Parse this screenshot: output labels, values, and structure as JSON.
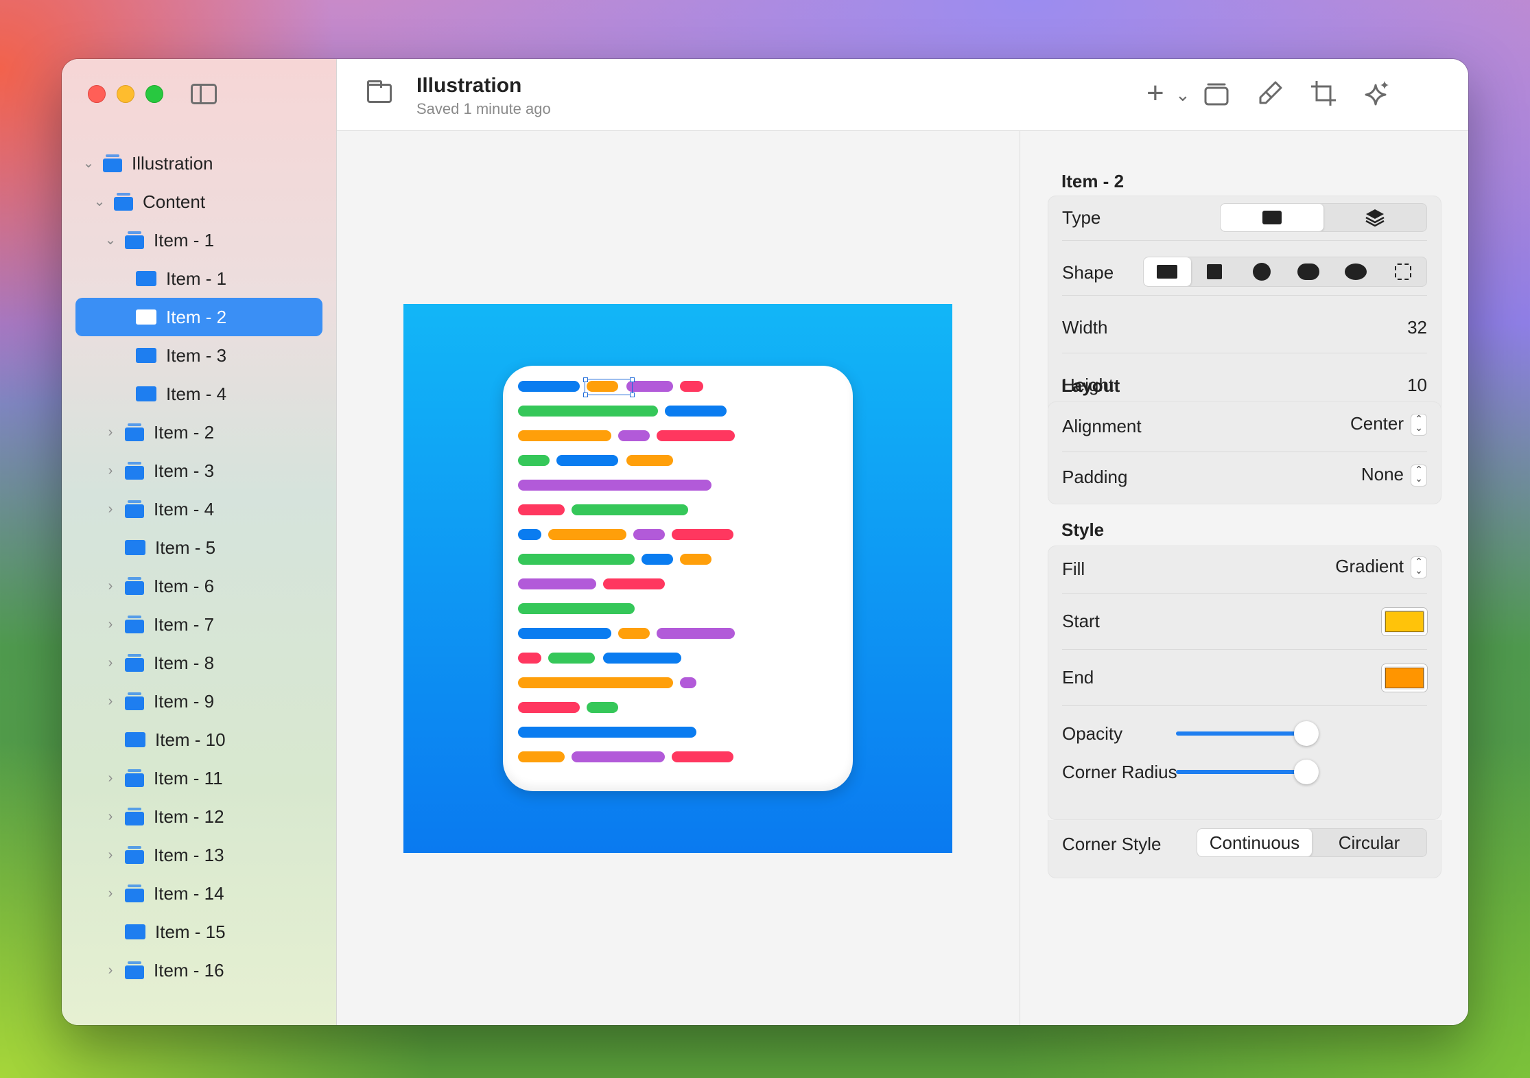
{
  "toolbar": {
    "title": "Illustration",
    "subtitle": "Saved 1 minute ago",
    "tools": [
      {
        "icon": "plus-icon",
        "label": "+"
      },
      {
        "icon": "chevron-down-icon",
        "label": "⌄"
      },
      {
        "icon": "frame-icon",
        "label": "⧉"
      },
      {
        "icon": "brush-icon",
        "label": "🖌"
      },
      {
        "icon": "crop-icon",
        "label": "⌗"
      },
      {
        "icon": "sparkle-icon",
        "label": "✦"
      }
    ]
  },
  "sidebar": {
    "tree": [
      {
        "label": "Illustration",
        "depth": 0,
        "chevron": "open",
        "icon": "stack"
      },
      {
        "label": "Content",
        "depth": 1,
        "chevron": "open",
        "icon": "stack"
      },
      {
        "label": "Item - 1",
        "depth": 2,
        "chevron": "open",
        "icon": "stack"
      },
      {
        "label": "Item - 1",
        "depth": 3,
        "chevron": "none",
        "icon": "rect"
      },
      {
        "label": "Item - 2",
        "depth": 3,
        "chevron": "none",
        "icon": "rect",
        "selected": true
      },
      {
        "label": "Item - 3",
        "depth": 3,
        "chevron": "none",
        "icon": "rect"
      },
      {
        "label": "Item - 4",
        "depth": 3,
        "chevron": "none",
        "icon": "rect"
      },
      {
        "label": "Item - 2",
        "depth": 2,
        "chevron": "closed",
        "icon": "stack"
      },
      {
        "label": "Item - 3",
        "depth": 2,
        "chevron": "closed",
        "icon": "stack"
      },
      {
        "label": "Item - 4",
        "depth": 2,
        "chevron": "closed",
        "icon": "stack"
      },
      {
        "label": "Item - 5",
        "depth": 2,
        "chevron": "none",
        "icon": "rect"
      },
      {
        "label": "Item - 6",
        "depth": 2,
        "chevron": "closed",
        "icon": "stack"
      },
      {
        "label": "Item - 7",
        "depth": 2,
        "chevron": "closed",
        "icon": "stack"
      },
      {
        "label": "Item - 8",
        "depth": 2,
        "chevron": "closed",
        "icon": "stack"
      },
      {
        "label": "Item - 9",
        "depth": 2,
        "chevron": "closed",
        "icon": "stack"
      },
      {
        "label": "Item - 10",
        "depth": 2,
        "chevron": "none",
        "icon": "rect"
      },
      {
        "label": "Item - 11",
        "depth": 2,
        "chevron": "closed",
        "icon": "stack"
      },
      {
        "label": "Item - 12",
        "depth": 2,
        "chevron": "closed",
        "icon": "stack"
      },
      {
        "label": "Item - 13",
        "depth": 2,
        "chevron": "closed",
        "icon": "stack"
      },
      {
        "label": "Item - 14",
        "depth": 2,
        "chevron": "closed",
        "icon": "stack"
      },
      {
        "label": "Item - 15",
        "depth": 2,
        "chevron": "none",
        "icon": "rect"
      },
      {
        "label": "Item - 16",
        "depth": 2,
        "chevron": "closed",
        "icon": "stack"
      }
    ]
  },
  "inspector": {
    "title": "Item - 2",
    "type_label": "Type",
    "shape_label": "Shape",
    "width_label": "Width",
    "width_value": "32",
    "height_label": "Height",
    "height_value": "10",
    "layout_title": "Layout",
    "alignment_label": "Alignment",
    "alignment_value": "Center",
    "padding_label": "Padding",
    "padding_value": "None",
    "style_title": "Style",
    "fill_label": "Fill",
    "fill_value": "Gradient",
    "start_label": "Start",
    "start_color": "#ffc30a",
    "end_label": "End",
    "end_color": "#ff9500",
    "opacity_label": "Opacity",
    "opacity_value": 1.0,
    "corner_radius_label": "Corner Radius",
    "corner_radius_value": 1.0,
    "corner_style_label": "Corner Style",
    "corner_style_options": [
      "Continuous",
      "Circular"
    ],
    "corner_style_selected": "Continuous"
  },
  "colors": {
    "accent": "#1e7ef0",
    "pill_blue": "#0a7cf0",
    "pill_green": "#35c759",
    "pill_orange": "#ff9f0a",
    "pill_purple": "#b25ad9",
    "pill_red": "#ff375f"
  }
}
